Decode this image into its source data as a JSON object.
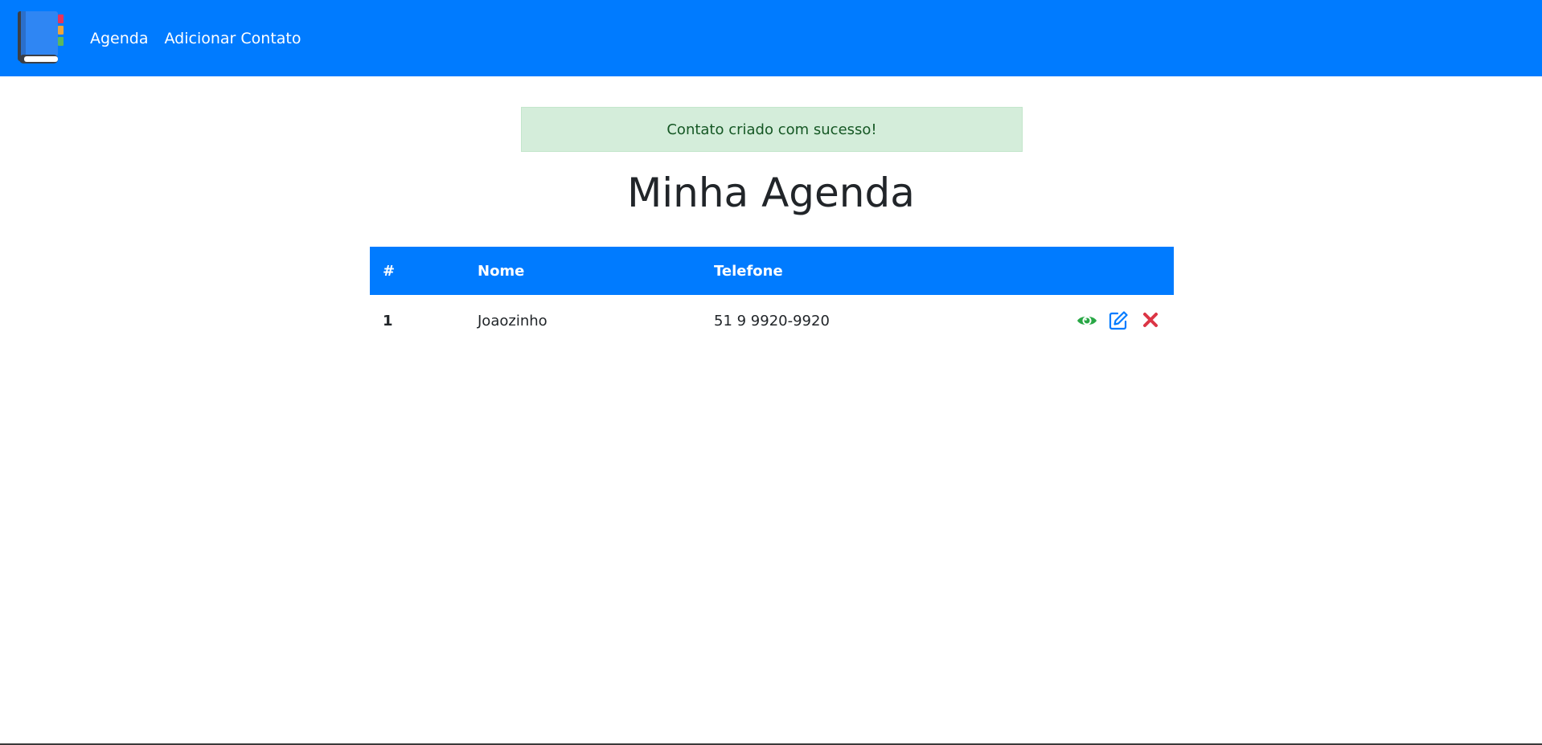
{
  "navbar": {
    "logo_icon": "address-book-icon",
    "links": [
      {
        "label": "Agenda"
      },
      {
        "label": "Adicionar Contato"
      }
    ],
    "background": "#007bff"
  },
  "alert": {
    "message": "Contato criado com sucesso!",
    "type": "success",
    "background": "#d4edda",
    "text_color": "#155724"
  },
  "page": {
    "title": "Minha Agenda"
  },
  "table": {
    "headers": [
      "#",
      "Nome",
      "Telefone",
      ""
    ],
    "rows": [
      {
        "id": "1",
        "name": "Joaozinho",
        "phone": "51 9 9920-9920",
        "actions": [
          {
            "icon": "eye-icon",
            "color": "#28a745"
          },
          {
            "icon": "edit-icon",
            "color": "#007bff"
          },
          {
            "icon": "delete-x-icon",
            "color": "#dc3545"
          }
        ]
      }
    ]
  }
}
